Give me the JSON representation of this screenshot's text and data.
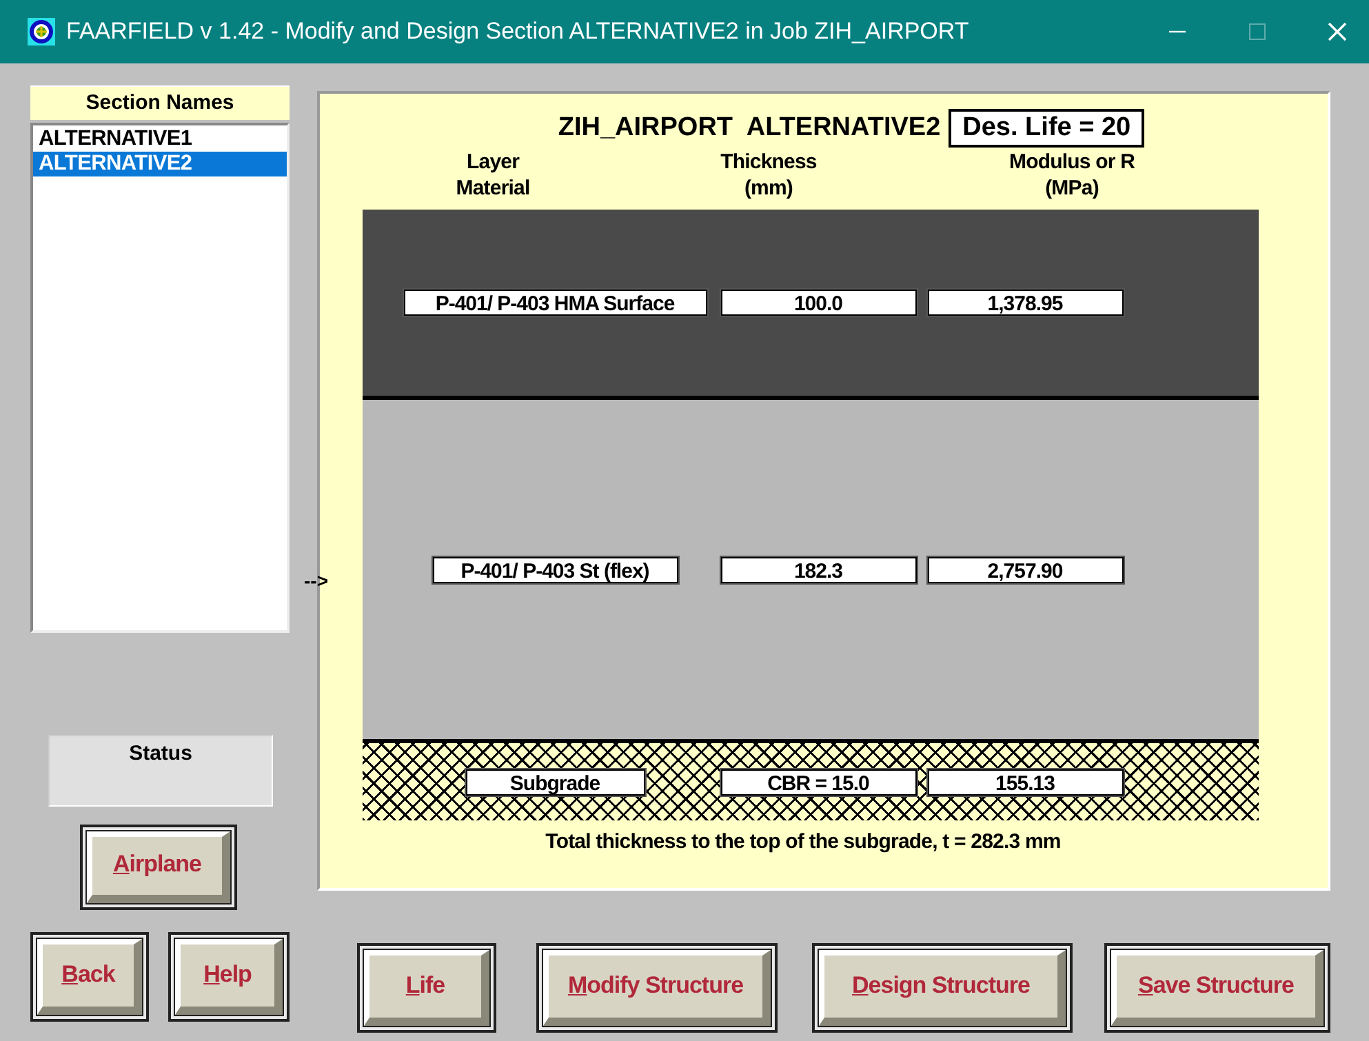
{
  "window": {
    "title": "FAARFIELD v 1.42 - Modify and Design Section ALTERNATIVE2 in Job ZIH_AIRPORT",
    "controls": [
      {
        "kind": "minimize",
        "disabled": false
      },
      {
        "kind": "maximize",
        "disabled": true
      },
      {
        "kind": "close",
        "disabled": false
      }
    ]
  },
  "sections": {
    "heading": "Section Names",
    "items": [
      {
        "label": "ALTERNATIVE1",
        "selected": false
      },
      {
        "label": "ALTERNATIVE2",
        "selected": true
      }
    ]
  },
  "status": {
    "label": "Status"
  },
  "structure": {
    "title": "ZIH_AIRPORT  ALTERNATIVE2",
    "design_life": "Des. Life = 20",
    "columns": [
      "Layer\nMaterial",
      "Thickness\n(mm)",
      "Modulus or R\n(MPa)"
    ],
    "layers": [
      {
        "kind": "surface",
        "material": "P-401/ P-403 HMA Surface",
        "thickness": "100.0",
        "modulus": "1,378.95"
      },
      {
        "kind": "base",
        "pointer": "-->",
        "material": "P-401/ P-403 St (flex)",
        "thickness": "182.3",
        "modulus": "2,757.90"
      },
      {
        "kind": "subgrade",
        "material": "Subgrade",
        "thickness": "CBR = 15.0",
        "modulus": "155.13"
      }
    ],
    "total": "Total thickness to the top of the subgrade, t = 282.3 mm"
  },
  "side_buttons": [
    "Airplane",
    "Back",
    "Help"
  ],
  "buttons": [
    "Life",
    "Modify Structure",
    "Design Structure",
    "Save Structure"
  ]
}
